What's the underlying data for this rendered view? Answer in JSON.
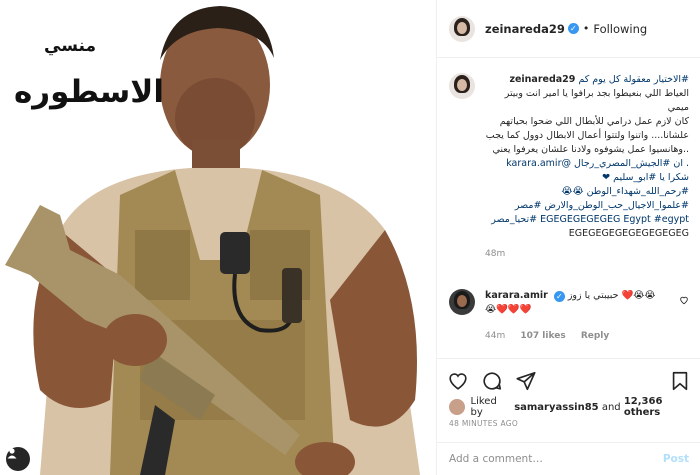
{
  "poster": {
    "subtitle": "منسي",
    "title": "الاسطوره"
  },
  "header": {
    "username": "zeinareda29",
    "separator": "•",
    "follow_label": "Following"
  },
  "caption": {
    "username": "zeinareda29",
    "line1": "#الاختيار معقولة كل يوم كم",
    "line2": "العياط اللي بنعيطوا بجد برافوا يا امير انت وبيتر ميمي",
    "line3": "كان لازم عمل درامي للأبطال اللي ضحوا بحياتهم علشانا.... واتنوا ولتتوا أعمال الابطال دوول كما يجب",
    "line4": "..وهانسيوا عمل يشوفوه ولادنا علشان يعرفوا يعني",
    "line5_mention": "@karara.amir",
    "line5_rest": ". ان #الجيش_المصري_رجال",
    "line6": "شكرا يا #ابو_سليم ❤",
    "line7": "#رحم_الله_شهداء_الوطن 😭😭",
    "line8": "#علموا_الاجيال_حب_الوطن_والارض #مصر",
    "line9": "EGEGEGEGEGEG Egypt #egypt #تحيا_مصر",
    "line10": "EGEGEGEGEGEGEGEGEG",
    "time": "48m"
  },
  "reply": {
    "username": "karara.amir",
    "text": "حبيبتي يا زوز ❤️😭😭",
    "text2": "😭❤️❤️❤️",
    "time": "44m",
    "likes": "107 likes",
    "reply_label": "Reply"
  },
  "likes": {
    "prefix": "Liked by",
    "user": "samaryassin85",
    "and": "and",
    "others": "12,366 others"
  },
  "timestamp": "48 MINUTES AGO",
  "add_comment": {
    "placeholder": "Add a comment…",
    "post_label": "Post"
  },
  "icons": [
    "heart-icon",
    "comment-icon",
    "share-icon",
    "bookmark-icon",
    "user-tag-icon",
    "verified-icon"
  ],
  "colors": {
    "link": "#00376b",
    "verified": "#3897f0",
    "muted": "#8e8e8e",
    "post_disabled": "#b2dffc"
  }
}
